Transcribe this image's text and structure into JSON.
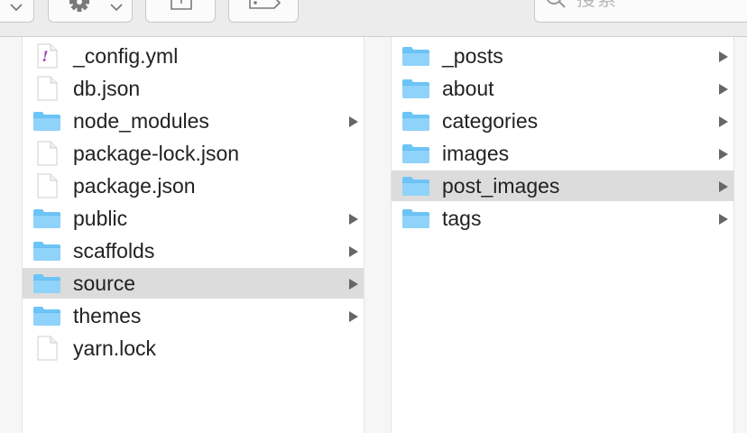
{
  "toolbar": {
    "search_placeholder": "搜索"
  },
  "columns": [
    {
      "items": [
        {
          "label": "_config.yml",
          "type": "yml-file",
          "has_children": false,
          "selected": false
        },
        {
          "label": "db.json",
          "type": "file",
          "has_children": false,
          "selected": false
        },
        {
          "label": "node_modules",
          "type": "folder",
          "has_children": true,
          "selected": false
        },
        {
          "label": "package-lock.json",
          "type": "file",
          "has_children": false,
          "selected": false
        },
        {
          "label": "package.json",
          "type": "file",
          "has_children": false,
          "selected": false
        },
        {
          "label": "public",
          "type": "folder",
          "has_children": true,
          "selected": false
        },
        {
          "label": "scaffolds",
          "type": "folder",
          "has_children": true,
          "selected": false
        },
        {
          "label": "source",
          "type": "folder",
          "has_children": true,
          "selected": true
        },
        {
          "label": "themes",
          "type": "folder",
          "has_children": true,
          "selected": false
        },
        {
          "label": "yarn.lock",
          "type": "file",
          "has_children": false,
          "selected": false
        }
      ]
    },
    {
      "items": [
        {
          "label": "_posts",
          "type": "folder",
          "has_children": true,
          "selected": false
        },
        {
          "label": "about",
          "type": "folder",
          "has_children": true,
          "selected": false
        },
        {
          "label": "categories",
          "type": "folder",
          "has_children": true,
          "selected": false
        },
        {
          "label": "images",
          "type": "folder",
          "has_children": true,
          "selected": false
        },
        {
          "label": "post_images",
          "type": "folder",
          "has_children": true,
          "selected": true
        },
        {
          "label": "tags",
          "type": "folder",
          "has_children": true,
          "selected": false
        }
      ]
    }
  ],
  "colors": {
    "folder": "#6cc4f7",
    "folder_tab": "#8fd3fb",
    "selection": "#dcdcdc"
  }
}
